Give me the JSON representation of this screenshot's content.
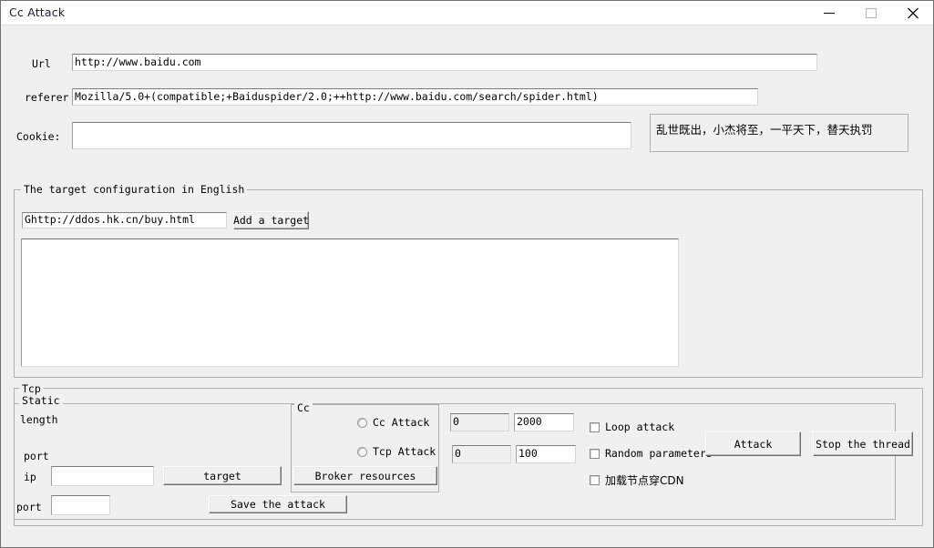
{
  "window": {
    "title": "Cc Attack",
    "controls": {
      "minimize": "minimize-icon",
      "maximize": "maximize-icon",
      "close": "close-icon"
    }
  },
  "form": {
    "url_label": "Url",
    "url_value": "http://www.baidu.com",
    "referer_label": "referer",
    "referer_value": "Mozilla/5.0+(compatible;+Baiduspider/2.0;++http://www.baidu.com/search/spider.html)",
    "cookie_label": "Cookie:",
    "cookie_value": "",
    "note_text": "乱世既出，小杰将至，一平天下，替天执罚"
  },
  "target_group": {
    "title": "The target configuration in English",
    "target_input_value": "Ghttp://ddos.hk.cn/buy.html",
    "add_target_label": "Add a target",
    "list_items": []
  },
  "tcp_group": {
    "title": "Tcp"
  },
  "static_group": {
    "title": "Static",
    "length_label": "length",
    "port_label_top": "port",
    "ip_label": "ip",
    "ip_value": "",
    "target_button_label": "target",
    "port_label_bottom": "port",
    "port_value": "",
    "save_attack_label": "Save the attack"
  },
  "cc_group": {
    "title": "Cc",
    "radios": [
      {
        "label": "Cc  Attack",
        "checked": false
      },
      {
        "label": "Tcp  Attack",
        "checked": false
      }
    ],
    "broker_button_label": "Broker resources"
  },
  "params": {
    "row1_left": "0",
    "row1_right": "2000",
    "row2_left": "0",
    "row2_right": "100"
  },
  "options": {
    "checkboxes": [
      {
        "label": "Loop attack",
        "checked": false,
        "cjk": false
      },
      {
        "label": "Random parameters",
        "checked": false,
        "cjk": false
      },
      {
        "label": "加载节点穿CDN",
        "checked": false,
        "cjk": true
      }
    ]
  },
  "actions": {
    "attack_label": "Attack",
    "stop_thread_label": "Stop the thread"
  },
  "colors": {
    "window_bg": "#f0f0f0",
    "titlebar_bg": "#ffffff",
    "field_bg": "#ffffff",
    "border": "#b0b0b0",
    "text": "#000000"
  }
}
